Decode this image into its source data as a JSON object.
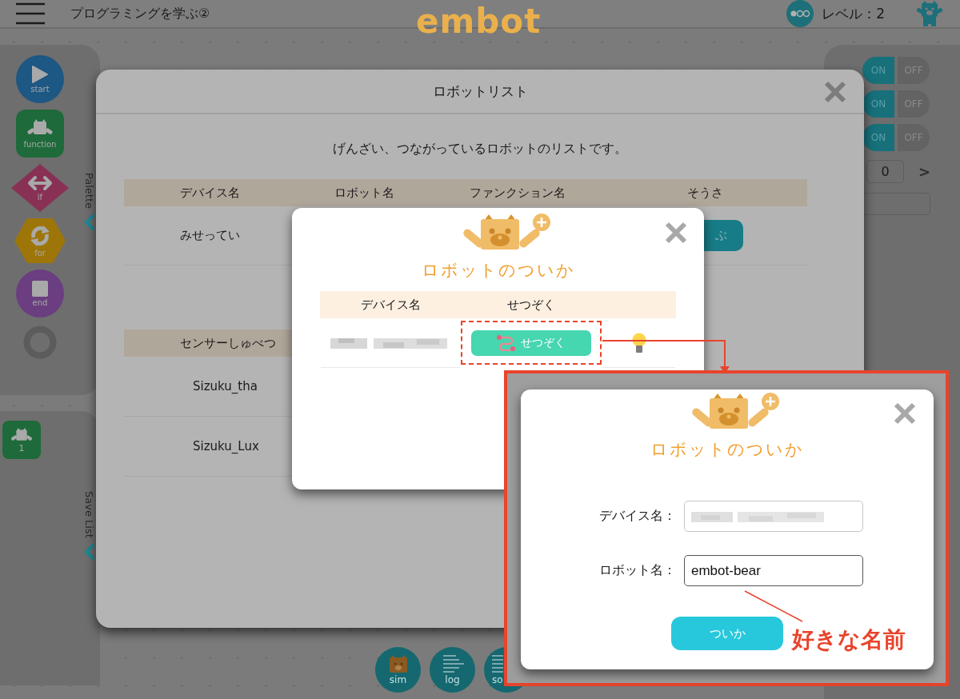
{
  "header": {
    "title": "プログラミングを学ぶ②",
    "logo": "embot",
    "level_label": "レベル：2"
  },
  "palette": {
    "label": "Palette",
    "blocks": [
      {
        "kind": "start",
        "label": "start"
      },
      {
        "kind": "function",
        "label": "function"
      },
      {
        "kind": "if",
        "label": "if"
      },
      {
        "kind": "for",
        "label": "for"
      },
      {
        "kind": "end",
        "label": "end"
      },
      {
        "kind": "ring"
      }
    ]
  },
  "save_list": {
    "label": "Save List",
    "items": [
      {
        "label": "1"
      }
    ]
  },
  "settings": {
    "toggles": [
      {
        "on_label": "ON",
        "off_label": "OFF",
        "on": true
      },
      {
        "on_label": "ON",
        "off_label": "OFF",
        "on": true
      },
      {
        "on_label": "ON",
        "off_label": "OFF",
        "on": true
      }
    ],
    "counter": "0",
    "next": ">"
  },
  "bottom_buttons": [
    {
      "kind": "sim",
      "label": "sim"
    },
    {
      "kind": "log",
      "label": "log"
    },
    {
      "kind": "sound",
      "label": "so"
    }
  ],
  "robot_list_dialog": {
    "title": "ロボットリスト",
    "subtitle": "げんざい、つながっているロボットのリストです。",
    "robot_table": {
      "columns": [
        "デバイス名",
        "ロボット名",
        "ファンクション名",
        "そうさ"
      ],
      "rows": [
        {
          "device": "みせってい",
          "action": "ぶ"
        }
      ]
    },
    "sensor_table": {
      "columns": [
        "センサーしゅべつ"
      ],
      "rows": [
        [
          "Sizuku_tha"
        ],
        [
          "Sizuku_Lux"
        ]
      ]
    }
  },
  "add_robot_dialog": {
    "title": "ロボットのついか",
    "columns": [
      "デバイス名",
      "せつぞく"
    ],
    "rows": [
      {
        "device_blurred": true,
        "connect_label": "せつぞく",
        "highlighted": true
      }
    ]
  },
  "callout": {
    "title": "ロボットのついか",
    "fields": [
      {
        "label": "デバイス名：",
        "blurred": true
      },
      {
        "label": "ロボット名：",
        "value": "embot-bear"
      }
    ],
    "submit": "ついか",
    "annotation": "好きな名前"
  }
}
